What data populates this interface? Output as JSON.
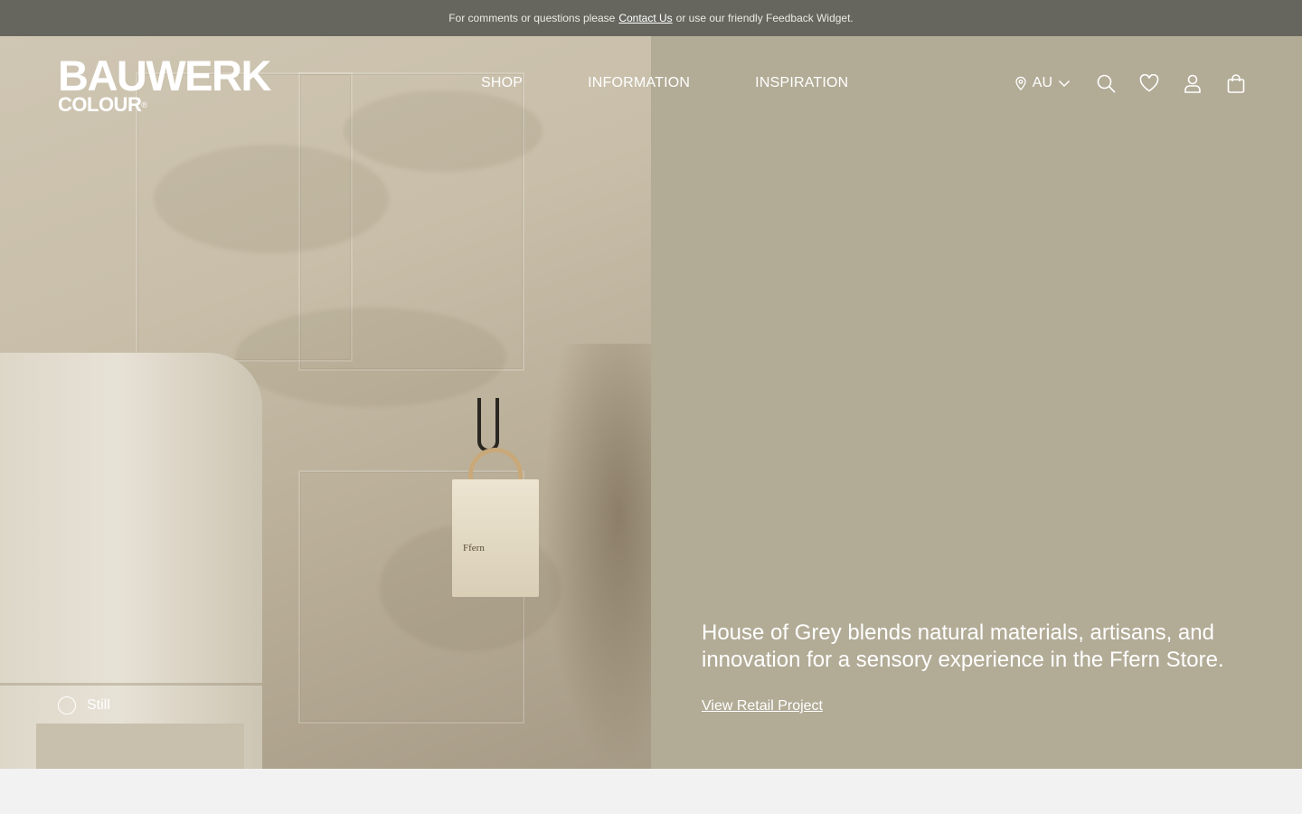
{
  "announcement": {
    "prefix": "For comments or questions please",
    "link": "Contact Us",
    "suffix": "or use our friendly Feedback Widget."
  },
  "header": {
    "logo_top": "BAUWERK",
    "logo_bottom": "COLOUR",
    "logo_mark": "®",
    "nav": [
      {
        "label": "SHOP"
      },
      {
        "label": "INFORMATION"
      },
      {
        "label": "INSPIRATION"
      }
    ],
    "region": "AU",
    "icons": [
      "location-pin-icon",
      "chevron-down-icon",
      "search-icon",
      "heart-icon",
      "account-icon",
      "bag-icon"
    ]
  },
  "hero": {
    "headline": "House of Grey blends natural materials, artisans, and innovation for a sensory experience in the Ffern Store.",
    "link": "View Retail Project",
    "toggle_label": "Still",
    "tote_text": "Ffern"
  },
  "colors": {
    "announcement_bg": "#66665f",
    "panel_bg": "#b2ab96",
    "text": "#ffffff",
    "page_bg": "#f2f2f2"
  }
}
